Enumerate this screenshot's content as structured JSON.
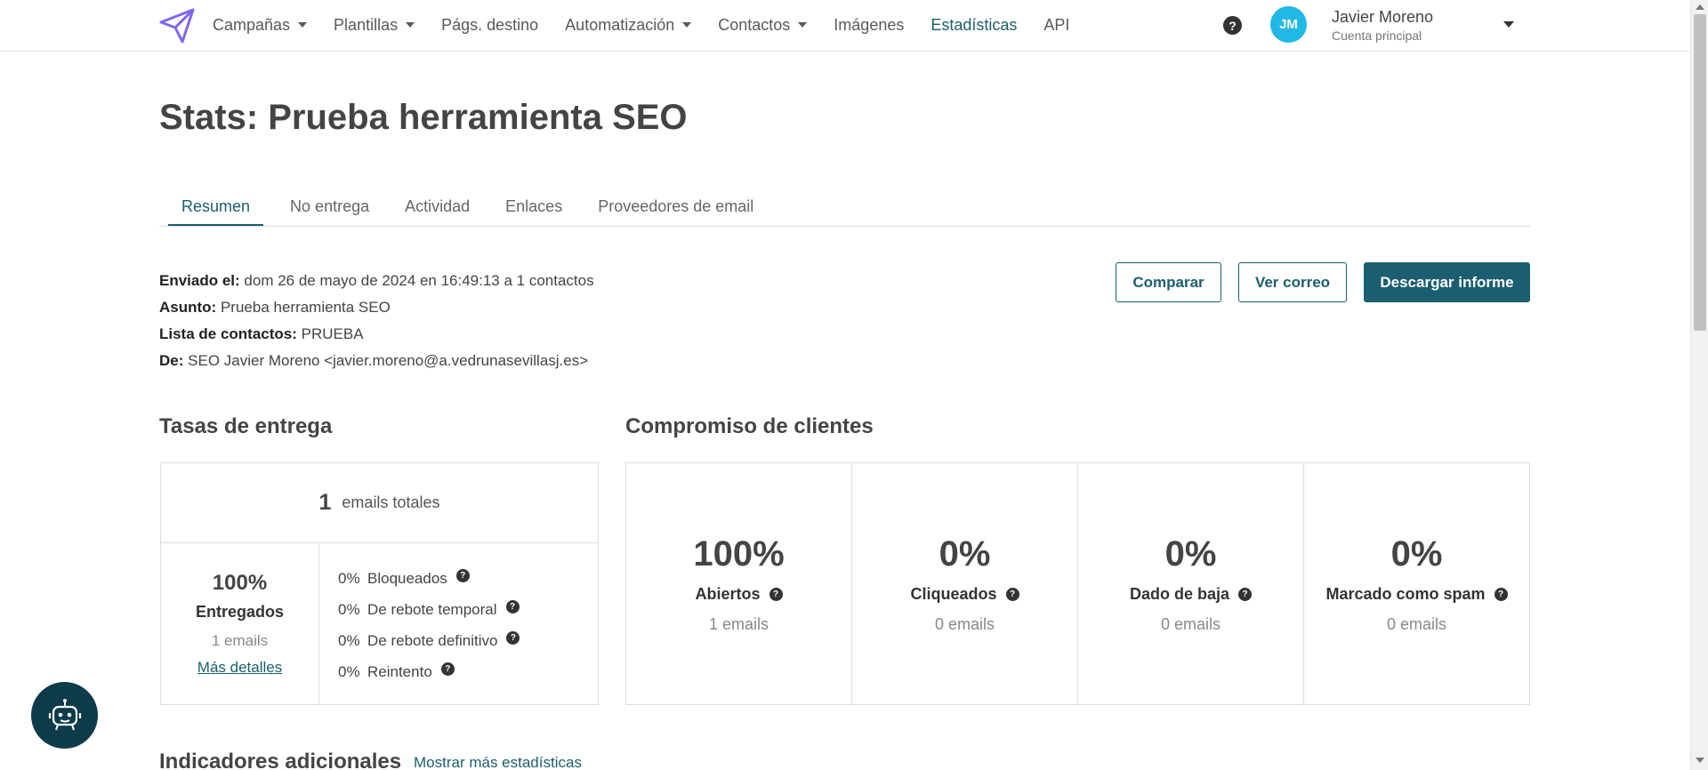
{
  "nav": {
    "items": [
      {
        "label": "Campañas",
        "dropdown": true
      },
      {
        "label": "Plantillas",
        "dropdown": true
      },
      {
        "label": "Págs. destino",
        "dropdown": false
      },
      {
        "label": "Automatización",
        "dropdown": true
      },
      {
        "label": "Contactos",
        "dropdown": true
      },
      {
        "label": "Imágenes",
        "dropdown": false
      },
      {
        "label": "Estadísticas",
        "dropdown": false,
        "active": true
      },
      {
        "label": "API",
        "dropdown": false
      }
    ],
    "help_glyph": "?",
    "user": {
      "initials": "JM",
      "name": "Javier Moreno",
      "account": "Cuenta principal"
    }
  },
  "page": {
    "title": "Stats: Prueba herramienta SEO"
  },
  "tabs": [
    "Resumen",
    "No entrega",
    "Actividad",
    "Enlaces",
    "Proveedores de email"
  ],
  "meta": {
    "sent_label": "Enviado el:",
    "sent_value": "dom 26 de mayo de 2024 en 16:49:13 a 1 contactos",
    "subject_label": "Asunto:",
    "subject_value": "Prueba herramienta SEO",
    "list_label": "Lista de contactos:",
    "list_value": "PRUEBA",
    "from_label": "De:",
    "from_value": "SEO Javier Moreno <javier.moreno@a.vedrunasevillasj.es>"
  },
  "actions": {
    "compare": "Comparar",
    "view_email": "Ver correo",
    "download": "Descargar informe"
  },
  "delivery": {
    "section_title": "Tasas de entrega",
    "total_num": "1",
    "total_label": "emails totales",
    "delivered_pct": "100%",
    "delivered_label": "Entregados",
    "delivered_count": "1 emails",
    "details_link": "Más detalles",
    "rows": [
      {
        "pct": "0%",
        "label": "Bloqueados"
      },
      {
        "pct": "0%",
        "label": "De rebote temporal"
      },
      {
        "pct": "0%",
        "label": "De rebote definitivo"
      },
      {
        "pct": "0%",
        "label": "Reintento"
      }
    ]
  },
  "engagement": {
    "section_title": "Compromiso de clientes",
    "cards": [
      {
        "pct": "100%",
        "label": "Abiertos",
        "count": "1 emails"
      },
      {
        "pct": "0%",
        "label": "Cliqueados",
        "count": "0 emails"
      },
      {
        "pct": "0%",
        "label": "Dado de baja",
        "count": "0 emails"
      },
      {
        "pct": "0%",
        "label": "Marcado como spam",
        "count": "0 emails"
      }
    ]
  },
  "additional": {
    "section_title": "Indicadores adicionales",
    "more_link": "Mostrar más estadísticas"
  },
  "colors": {
    "accent": "#1b5e6f",
    "avatar": "#22b8e6",
    "logo": "#7b68ee",
    "chatbot": "#0d3b4a"
  }
}
